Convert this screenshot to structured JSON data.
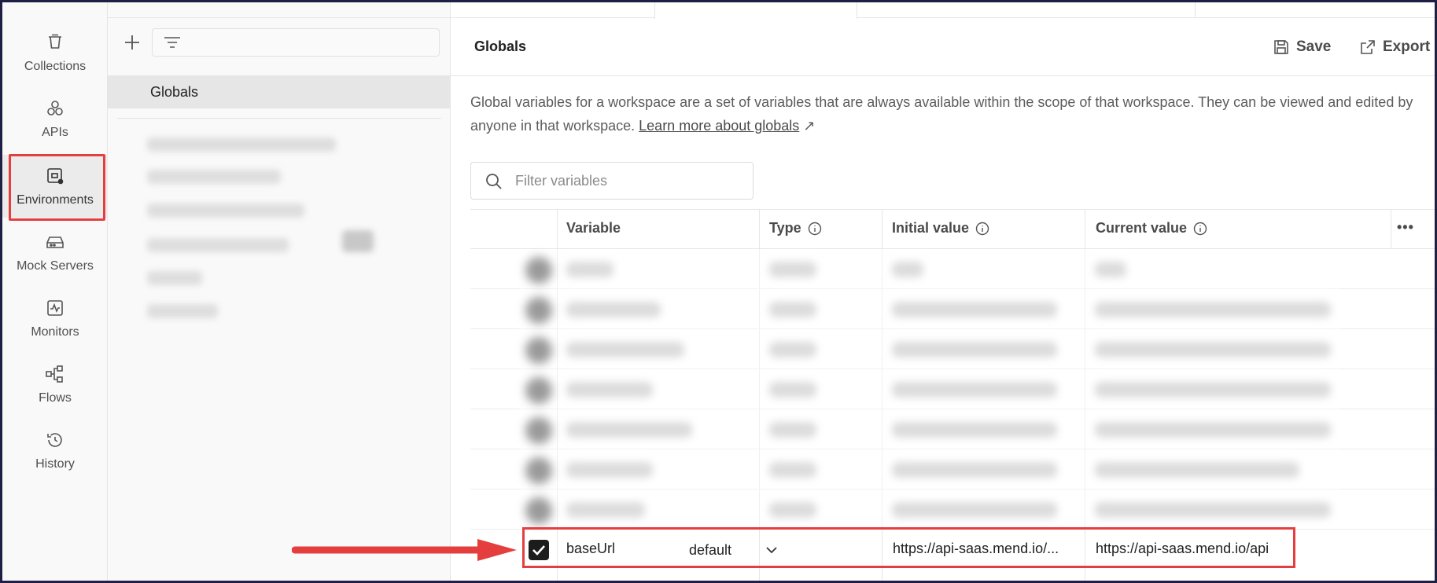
{
  "rail": {
    "items": [
      {
        "label": "Collections",
        "icon": "collections-icon"
      },
      {
        "label": "APIs",
        "icon": "apis-icon"
      },
      {
        "label": "Environments",
        "icon": "environments-icon"
      },
      {
        "label": "Mock Servers",
        "icon": "mock-servers-icon"
      },
      {
        "label": "Monitors",
        "icon": "monitors-icon"
      },
      {
        "label": "Flows",
        "icon": "flows-icon"
      },
      {
        "label": "History",
        "icon": "history-icon"
      }
    ]
  },
  "sidebar": {
    "selected_item": "Globals"
  },
  "header": {
    "title": "Globals",
    "save_label": "Save",
    "export_label": "Export"
  },
  "description": {
    "text": "Global variables for a workspace are a set of variables that are always available within the scope of that workspace. They can be viewed and edited by anyone in that workspace.",
    "link_text": "Learn more about globals",
    "link_arrow": "↗"
  },
  "filter": {
    "placeholder": "Filter variables"
  },
  "table": {
    "columns": [
      "Variable",
      "Type",
      "Initial value",
      "Current value"
    ],
    "more_label": "•••",
    "highlighted_row": {
      "checked": true,
      "variable": "baseUrl",
      "type": "default",
      "initial_value": "https://api-saas.mend.io/...",
      "current_value": "https://api-saas.mend.io/api"
    }
  },
  "colors": {
    "highlight": "#e53e3e",
    "frame": "#1f1f45"
  }
}
